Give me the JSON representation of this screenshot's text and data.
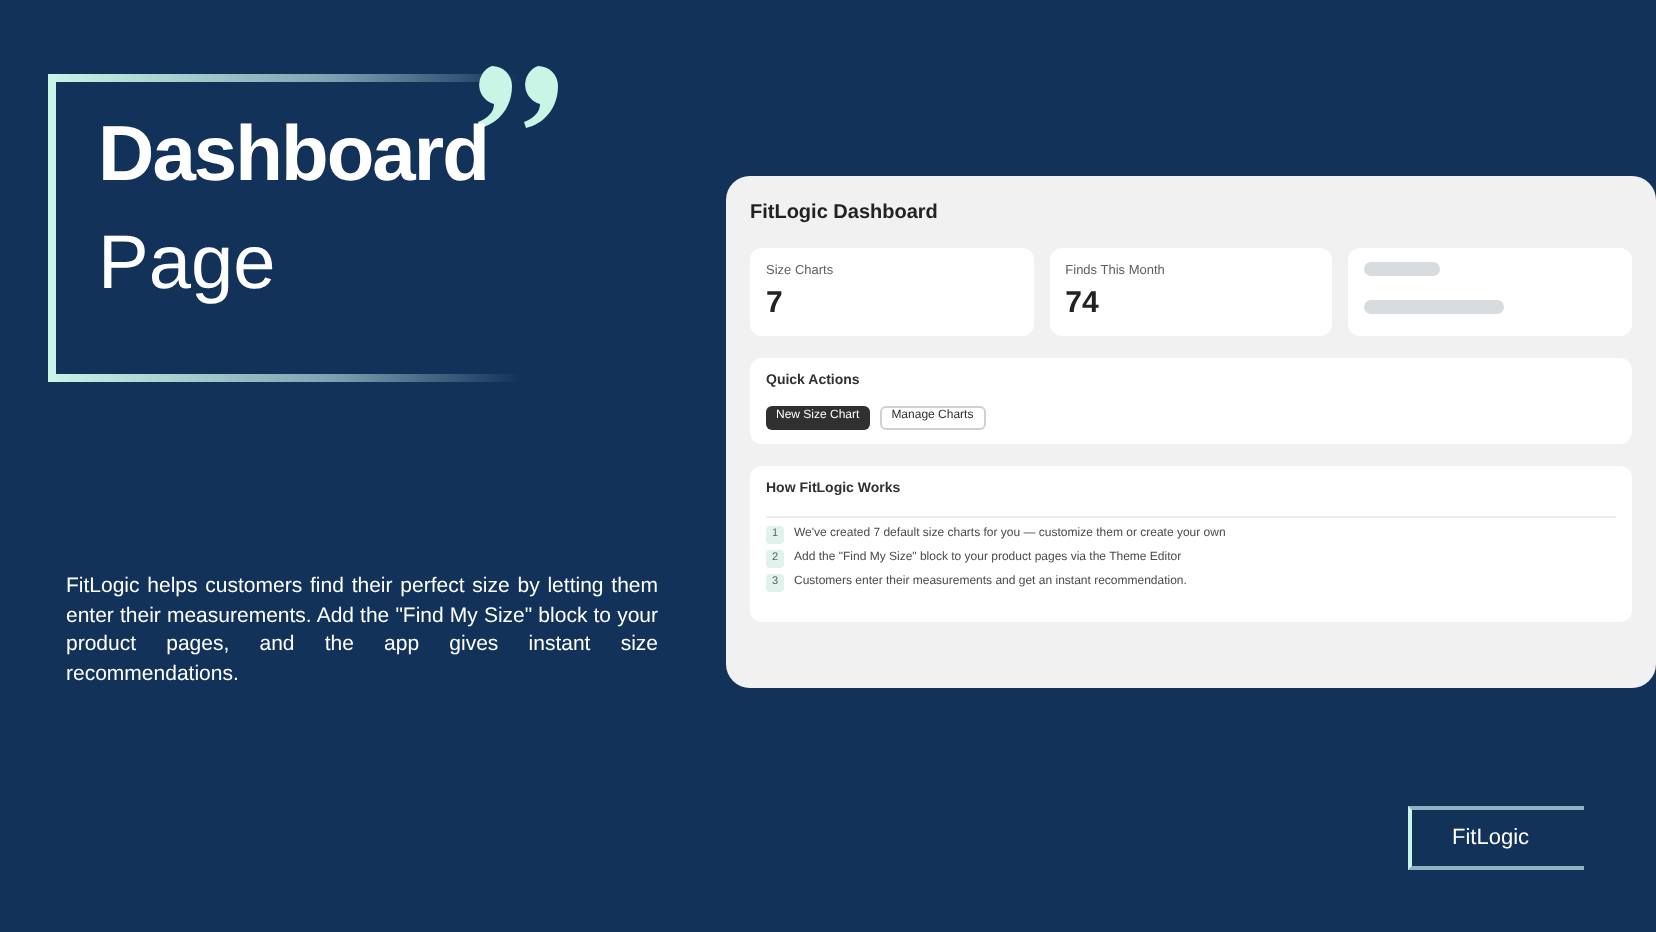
{
  "heading": {
    "title": "Dashboard",
    "subtitle": "Page"
  },
  "description": "FitLogic helps customers find their perfect size by letting them enter their measurements. Add the \"Find My Size\" block to your product pages, and the app gives instant size recommendations.",
  "dashboard": {
    "title": "FitLogic Dashboard",
    "cards": [
      {
        "kind": "stat",
        "label": "Size Charts",
        "value": "7"
      },
      {
        "kind": "stat",
        "label": "Finds This Month",
        "value": "74"
      },
      {
        "kind": "loading"
      }
    ],
    "quick_actions": {
      "title": "Quick Actions",
      "buttons": [
        {
          "label": "New Size Chart",
          "primary": true
        },
        {
          "label": "Manage Charts",
          "primary": false
        }
      ]
    },
    "how_it_works": {
      "title": "How FitLogic Works",
      "steps": [
        {
          "number": "1",
          "text": "We've created 7 default size charts for you — customize them or create your own"
        },
        {
          "number": "2",
          "text": "Add the \"Find My Size\" block to your product pages via the Theme Editor"
        },
        {
          "number": "3",
          "text": "Customers enter their measurements and get an instant recommendation."
        }
      ]
    }
  },
  "brand": "FitLogic"
}
